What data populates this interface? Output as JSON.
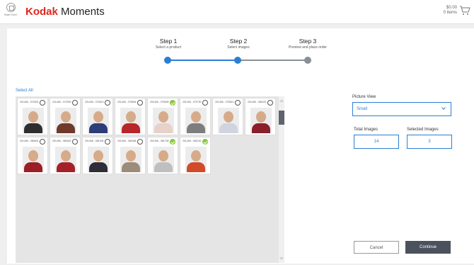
{
  "header": {
    "home_label": "Start Over",
    "brand_kodak": "Kodak",
    "brand_moments": "Moments",
    "cart_total": "$0.00",
    "cart_items": "0 items"
  },
  "steps": [
    {
      "title": "Step 1",
      "subtitle": "Select a product",
      "status": "complete"
    },
    {
      "title": "Step 2",
      "subtitle": "Select images",
      "status": "current"
    },
    {
      "title": "Step 3",
      "subtitle": "Preview and place order",
      "status": "upcoming"
    }
  ],
  "colors": {
    "accent": "#2a7fd4",
    "brand_red": "#e1261c",
    "selected_check": "#8dc63f",
    "step_inactive": "#8a8f96",
    "button_dark": "#4b525d"
  },
  "gallery": {
    "select_all_label": "Select All",
    "photos": [
      {
        "name": "201406 - 072501",
        "selected": false,
        "shirt": "#2e2e2e"
      },
      {
        "name": "201406 - 072900",
        "selected": false,
        "shirt": "#6f3a2a"
      },
      {
        "name": "201406 - 073613",
        "selected": false,
        "shirt": "#2c3d78"
      },
      {
        "name": "201406 - 075604",
        "selected": false,
        "shirt": "#b8252a"
      },
      {
        "name": "201406 - 075628",
        "selected": true,
        "shirt": "#e7d1c8"
      },
      {
        "name": "201406 - 075730",
        "selected": false,
        "shirt": "#7d7d7d"
      },
      {
        "name": "201406 - 075810",
        "selected": false,
        "shirt": "#cfd4df"
      },
      {
        "name": "201406 - 080022",
        "selected": false,
        "shirt": "#8b1f2a"
      },
      {
        "name": "201406 - 080602",
        "selected": false,
        "shirt": "#9b1f25"
      },
      {
        "name": "201406 - 080642",
        "selected": false,
        "shirt": "#a5212a"
      },
      {
        "name": "201406 - 081108",
        "selected": false,
        "shirt": "#2e2e38"
      },
      {
        "name": "201406 - 081548",
        "selected": false,
        "shirt": "#9b8c7b"
      },
      {
        "name": "201406 - 081708",
        "selected": true,
        "shirt": "#bfbfbf"
      },
      {
        "name": "201406 - 082100",
        "selected": true,
        "shirt": "#d14a2a"
      }
    ]
  },
  "controls": {
    "picture_view_label": "Picture View",
    "picture_view_value": "Small",
    "total_images_label": "Total Images",
    "total_images_value": "14",
    "selected_images_label": "Selected Images",
    "selected_images_value": "3",
    "cancel_label": "Cancel",
    "continue_label": "Continue"
  }
}
